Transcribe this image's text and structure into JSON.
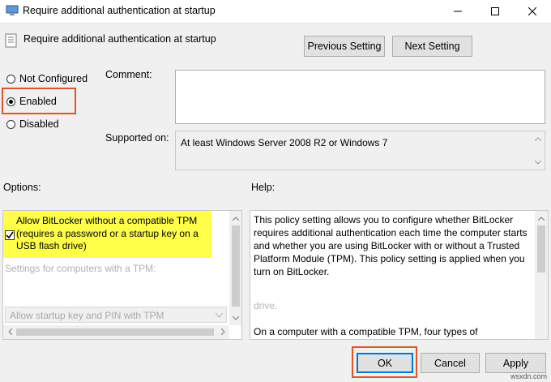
{
  "window": {
    "title": "Require additional authentication at startup",
    "minimize_icon": "minimize-icon",
    "maximize_icon": "maximize-icon",
    "close_icon": "close-icon"
  },
  "header": {
    "policy_name": "Require additional authentication at startup",
    "prev_button": "Previous Setting",
    "next_button": "Next Setting"
  },
  "state": {
    "options": [
      {
        "label": "Not Configured",
        "selected": false
      },
      {
        "label": "Enabled",
        "selected": true
      },
      {
        "label": "Disabled",
        "selected": false
      }
    ]
  },
  "comment": {
    "label": "Comment:",
    "value": ""
  },
  "supported": {
    "label": "Supported on:",
    "value": "At least Windows Server 2008 R2 or Windows 7"
  },
  "options_panel": {
    "label": "Options:",
    "checkbox_label": "Allow BitLocker without a compatible TPM (requires a password or a startup key on a USB flash drive)",
    "checkbox_checked": true,
    "tpm_heading": "Settings for computers with a TPM:",
    "dropdown_value": "Allow startup key and PIN with TPM",
    "highlight_color": "#ffff4a"
  },
  "help_panel": {
    "label": "Help:",
    "paragraph1": "This policy setting allows you to configure whether BitLocker requires additional authentication each time the computer starts and whether you are using BitLocker with or without a Trusted Platform Module (TPM). This policy setting is applied when you turn on BitLocker.",
    "fragment": "drive.",
    "paragraph2": "On a computer with a compatible TPM, four types of"
  },
  "footer": {
    "ok": "OK",
    "cancel": "Cancel",
    "apply": "Apply",
    "watermark": "wsxdn.com"
  },
  "colors": {
    "accent_outline": "#e0542a",
    "selection_blue": "#0078d7"
  }
}
